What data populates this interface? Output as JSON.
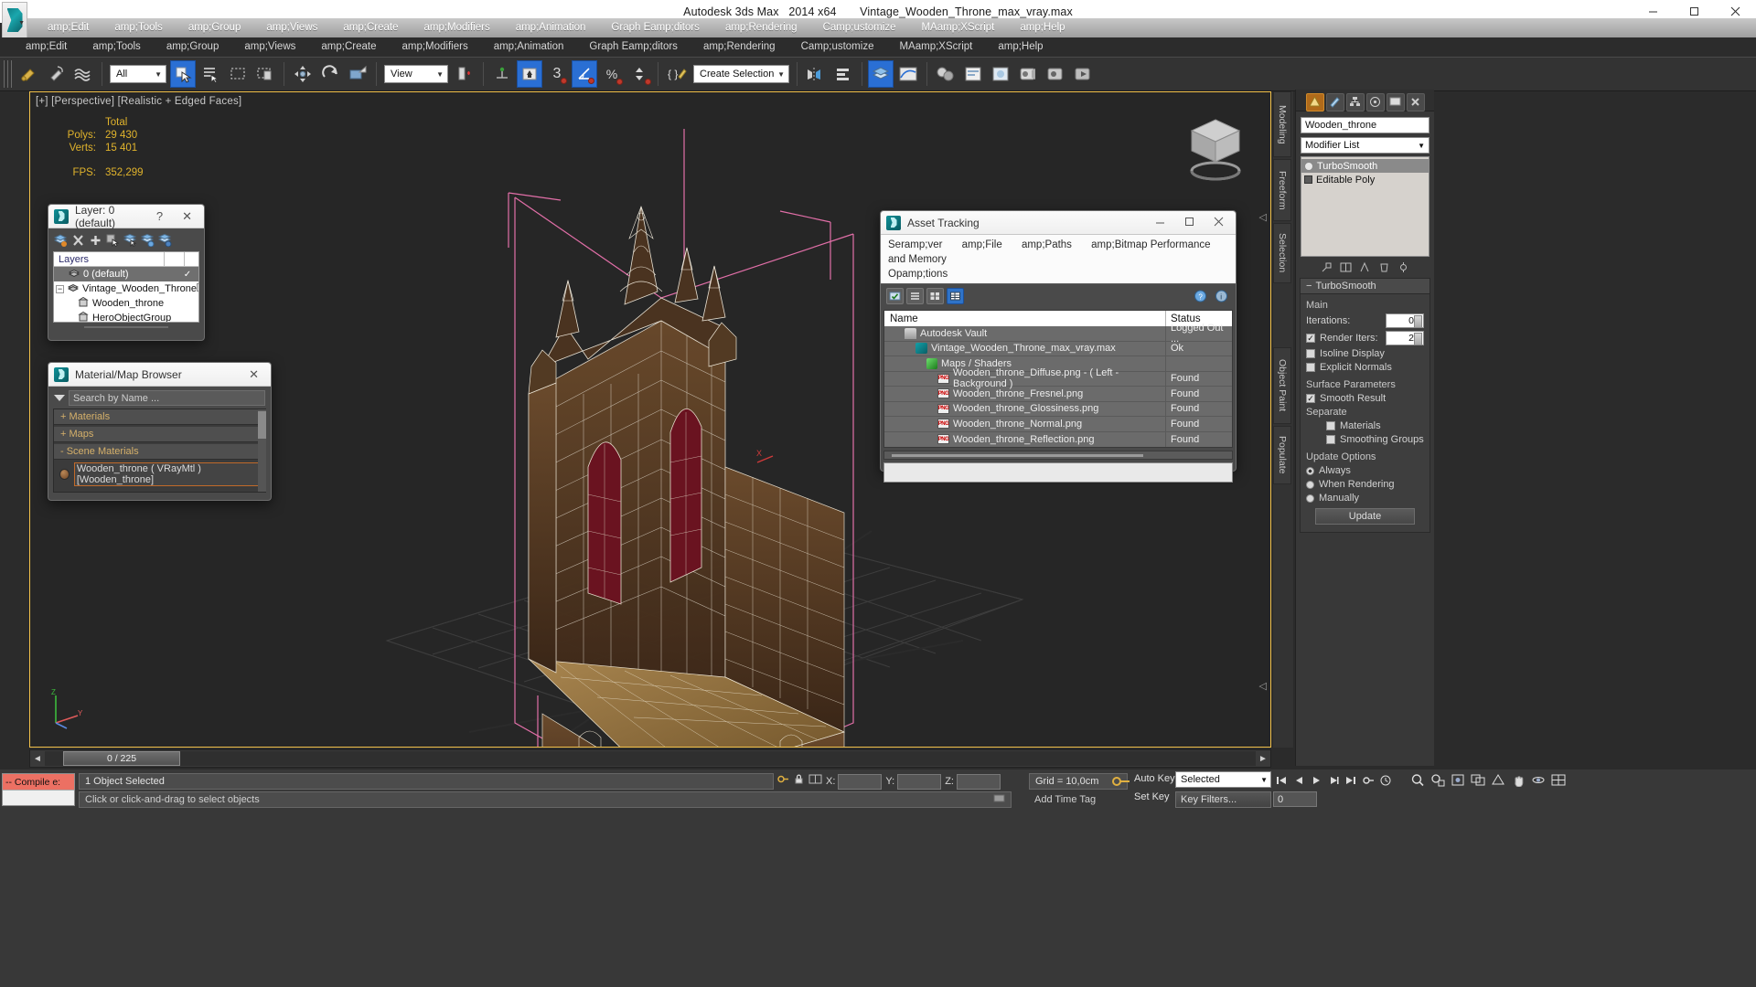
{
  "window": {
    "app_title": "Autodesk 3ds Max",
    "version": "2014 x64",
    "file_name": "Vintage_Wooden_Throne_max_vray.max",
    "minimize": "minimize-icon",
    "maximize": "maximize-icon",
    "close": "close-icon"
  },
  "menu": {
    "items": [
      "amp;Edit",
      "amp;Tools",
      "amp;Group",
      "amp;Views",
      "amp;Create",
      "amp;Modifiers",
      "amp;Animation",
      "Graph Eamp;ditors",
      "amp;Rendering",
      "Camp;ustomize",
      "MAamp;XScript",
      "amp;Help"
    ]
  },
  "toolbar": {
    "selection_filter": "All",
    "reference_coord": "View",
    "named_selection": "Create Selection Se",
    "snap_value": "3",
    "percent_symbol": "%",
    "icons": [
      "undo-icon",
      "redo-icon",
      "select-link-icon",
      "unlink-icon",
      "bind-space-warp-icon",
      "select-object-icon",
      "select-by-name-icon",
      "rectangular-region-icon",
      "window-crossing-icon",
      "select-move-icon",
      "select-rotate-icon",
      "select-scale-icon",
      "use-pivot-icon",
      "snaps-toggle-icon",
      "angle-snap-icon",
      "percent-snap-icon",
      "spinner-snap-icon",
      "edit-named-selection-icon",
      "mirror-icon",
      "align-icon",
      "layer-manager-icon",
      "curve-editor-icon",
      "schematic-view-icon",
      "material-editor-icon",
      "render-setup-icon",
      "rendered-frame-icon",
      "render-production-icon"
    ]
  },
  "viewport": {
    "label": "[+] [Perspective] [Realistic + Edged Faces]",
    "stats_header": "Total",
    "polys_label": "Polys:",
    "polys_value": "29 430",
    "verts_label": "Verts:",
    "verts_value": "15 401",
    "fps_label": "FPS:",
    "fps_value": "352,299",
    "axis_x": "X",
    "axis_y": "Y",
    "axis_z": "Z"
  },
  "layer_window": {
    "title": "Layer: 0 (default)",
    "help_btn": "?",
    "close_btn": "✕",
    "tool_icons": [
      "new-layer-icon",
      "delete-layer-icon",
      "add-selection-icon",
      "select-objects-icon",
      "set-current-layer-icon",
      "select-highlight-icon",
      "layer-properties-icon"
    ],
    "column_header": "Layers",
    "rows": [
      {
        "name": "0 (default)",
        "icon": "layer-icon",
        "checked": "✓",
        "indent": 1,
        "selected": true,
        "expander": ""
      },
      {
        "name": "Vintage_Wooden_Throne",
        "icon": "layer-icon",
        "checked": "",
        "indent": 0,
        "selected": false,
        "expander": "−"
      },
      {
        "name": "Wooden_throne",
        "icon": "object-icon",
        "checked": "",
        "indent": 2,
        "selected": false,
        "expander": ""
      },
      {
        "name": "HeroObjectGroup",
        "icon": "object-icon",
        "checked": "",
        "indent": 2,
        "selected": false,
        "expander": ""
      }
    ]
  },
  "material_browser": {
    "title": "Material/Map Browser",
    "close_btn": "✕",
    "search_placeholder": "Search by Name ...",
    "groups": [
      {
        "label": "+ Materials",
        "expanded": false
      },
      {
        "label": "+ Maps",
        "expanded": false
      },
      {
        "label": "- Scene Materials",
        "expanded": true
      }
    ],
    "scene_materials": [
      {
        "name": "Wooden_throne  ( VRayMtl )  [Wooden_throne]",
        "swatch": "#8a5a30"
      }
    ]
  },
  "asset_tracking": {
    "title": "Asset Tracking",
    "minimize": "minimize-icon",
    "maximize": "maximize-icon",
    "close": "close-icon",
    "menu_line1": [
      "Seramp;ver",
      "amp;File",
      "amp;Paths",
      "amp;Bitmap Performance and Memory"
    ],
    "menu_line2": [
      "Opamp;tions"
    ],
    "toolbar_icons": [
      "check-in-icon",
      "list-view-icon",
      "thumbnail-view-icon",
      "grid-view-icon",
      "help-icon",
      "about-icon"
    ],
    "columns": [
      "Name",
      "Status"
    ],
    "rows": [
      {
        "name": "Autodesk Vault",
        "status": "Logged Out ...",
        "icon": "vault-icon",
        "indent": 0
      },
      {
        "name": "Vintage_Wooden_Throne_max_vray.max",
        "status": "Ok",
        "icon": "max-file-icon",
        "indent": 1
      },
      {
        "name": "Maps / Shaders",
        "status": "",
        "icon": "maps-shaders-icon",
        "indent": 2
      },
      {
        "name": "Wooden_throne_Diffuse.png -  ( Left - Background )",
        "status": "Found",
        "icon": "png-icon",
        "indent": 3
      },
      {
        "name": "Wooden_throne_Fresnel.png",
        "status": "Found",
        "icon": "png-icon",
        "indent": 3
      },
      {
        "name": "Wooden_throne_Glossiness.png",
        "status": "Found",
        "icon": "png-icon",
        "indent": 3
      },
      {
        "name": "Wooden_throne_Normal.png",
        "status": "Found",
        "icon": "png-icon",
        "indent": 3
      },
      {
        "name": "Wooden_throne_Reflection.png",
        "status": "Found",
        "icon": "png-icon",
        "indent": 3
      }
    ]
  },
  "command_panel": {
    "tabs": [
      "Modeling",
      "Freeform",
      "Selection",
      "Object Paint",
      "Populate"
    ],
    "panel_icons": [
      "create-icon",
      "modify-icon",
      "hierarchy-icon",
      "motion-icon",
      "display-icon",
      "utilities-icon"
    ],
    "object_name": "Wooden_throne",
    "modifier_list_label": "Modifier List",
    "stack": [
      {
        "label": "TurboSmooth",
        "active": true
      },
      {
        "label": "Editable Poly",
        "active": false
      }
    ],
    "rollup_title": "TurboSmooth",
    "main_group": "Main",
    "iterations_label": "Iterations:",
    "iterations_value": "0",
    "render_iters_label": "Render Iters:",
    "render_iters_value": "2",
    "isoline_display": "Isoline Display",
    "explicit_normals": "Explicit Normals",
    "surface_params_group": "Surface Parameters",
    "smooth_result": "Smooth Result",
    "separate_label": "Separate",
    "separate_materials": "Materials",
    "separate_smoothing": "Smoothing Groups",
    "update_options_group": "Update Options",
    "update_always": "Always",
    "update_when_rendering": "When Rendering",
    "update_manually": "Manually",
    "update_button": "Update"
  },
  "timeline": {
    "current_frame": "0 / 225",
    "left_arrow": "◄",
    "right_arrow": "►"
  },
  "status": {
    "maxscript_label": "-- Compile e:",
    "selection_text": "1 Object Selected",
    "prompt_text": "Click or click-and-drag to select objects",
    "x_label": "X:",
    "x_value": "",
    "y_label": "Y:",
    "y_value": "",
    "z_label": "Z:",
    "z_value": "",
    "grid_label": "Grid = 10,0cm",
    "add_time_tag": "Add Time Tag",
    "auto_key": "Auto Key",
    "set_key": "Set Key",
    "selected_filter": "Selected",
    "key_filters": "Key Filters...",
    "frame_value": "0",
    "lock_icon": "lock-icon",
    "key_icon": "key-icon",
    "absolute_mode_icon": "absolute-mode-icon"
  }
}
